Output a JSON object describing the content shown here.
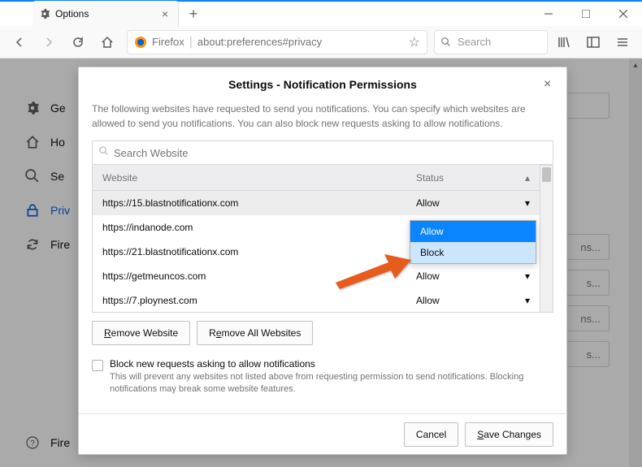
{
  "tab": {
    "title": "Options"
  },
  "urlbar": {
    "identity": "Firefox",
    "text": "about:preferences#privacy"
  },
  "searchbar": {
    "placeholder": "Search"
  },
  "sidebar": {
    "items": [
      {
        "label": "Ge"
      },
      {
        "label": "Ho"
      },
      {
        "label": "Se"
      },
      {
        "label": "Priv"
      },
      {
        "label": "Fire"
      }
    ],
    "help": "Fire"
  },
  "results": {
    "r1": "ns...",
    "r2": "s...",
    "r3": "ns...",
    "r4": "s..."
  },
  "dialog": {
    "title": "Settings - Notification Permissions",
    "description": "The following websites have requested to send you notifications. You can specify which websites are allowed to send you notifications. You can also block new requests asking to allow notifications.",
    "search_placeholder": "Search Website",
    "th_website": "Website",
    "th_status": "Status",
    "rows": [
      {
        "site": "https://15.blastnotificationx.com",
        "status": "Allow"
      },
      {
        "site": "https://indanode.com",
        "status": ""
      },
      {
        "site": "https://21.blastnotificationx.com",
        "status": ""
      },
      {
        "site": "https://getmeuncos.com",
        "status": "Allow"
      },
      {
        "site": "https://7.ploynest.com",
        "status": "Allow"
      }
    ],
    "dropdown": {
      "allow": "Allow",
      "block": "Block"
    },
    "remove_website": "Remove Website",
    "remove_all": "Remove All Websites",
    "checkbox_label": "Block new requests asking to allow notifications",
    "checkbox_desc": "This will prevent any websites not listed above from requesting permission to send notifications. Blocking notifications may break some website features.",
    "cancel": "Cancel",
    "save": "Save Changes"
  }
}
